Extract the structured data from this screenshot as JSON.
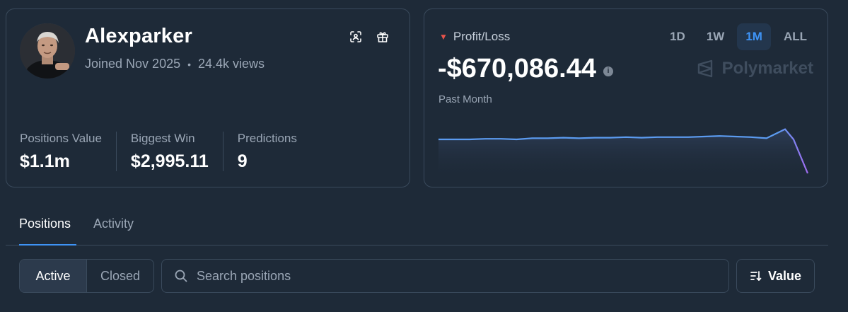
{
  "profile": {
    "username": "Alexparker",
    "joined": "Joined Nov 2025",
    "views": "24.4k views",
    "meta_separator": "•",
    "icons": [
      "scan-icon",
      "gift-icon"
    ],
    "stats": [
      {
        "label": "Positions Value",
        "value": "$1.1m"
      },
      {
        "label": "Biggest Win",
        "value": "$2,995.11"
      },
      {
        "label": "Predictions",
        "value": "9"
      }
    ]
  },
  "pnl": {
    "label": "Profit/Loss",
    "indicator": "▼",
    "value": "-$670,086.44",
    "info_glyph": "i",
    "period": "Past Month",
    "brand": "Polymarket",
    "ranges": [
      {
        "label": "1D",
        "active": false
      },
      {
        "label": "1W",
        "active": false
      },
      {
        "label": "1M",
        "active": true
      },
      {
        "label": "ALL",
        "active": false
      }
    ],
    "colors": {
      "line": "#5b9bf0",
      "line_end": "#a06cf0",
      "negative": "#e5534b"
    },
    "sparkline": [
      0.3,
      0.3,
      0.3,
      0.29,
      0.29,
      0.3,
      0.28,
      0.28,
      0.27,
      0.28,
      0.27,
      0.27,
      0.26,
      0.27,
      0.26,
      0.26,
      0.26,
      0.25,
      0.24,
      0.25,
      0.26,
      0.28,
      0.12,
      0.3,
      0.9
    ]
  },
  "tabs": [
    {
      "label": "Positions",
      "active": true
    },
    {
      "label": "Activity",
      "active": false
    }
  ],
  "filters": {
    "segments": [
      {
        "label": "Active",
        "active": true
      },
      {
        "label": "Closed",
        "active": false
      }
    ],
    "search_placeholder": "Search positions",
    "sort_label": "Value"
  }
}
